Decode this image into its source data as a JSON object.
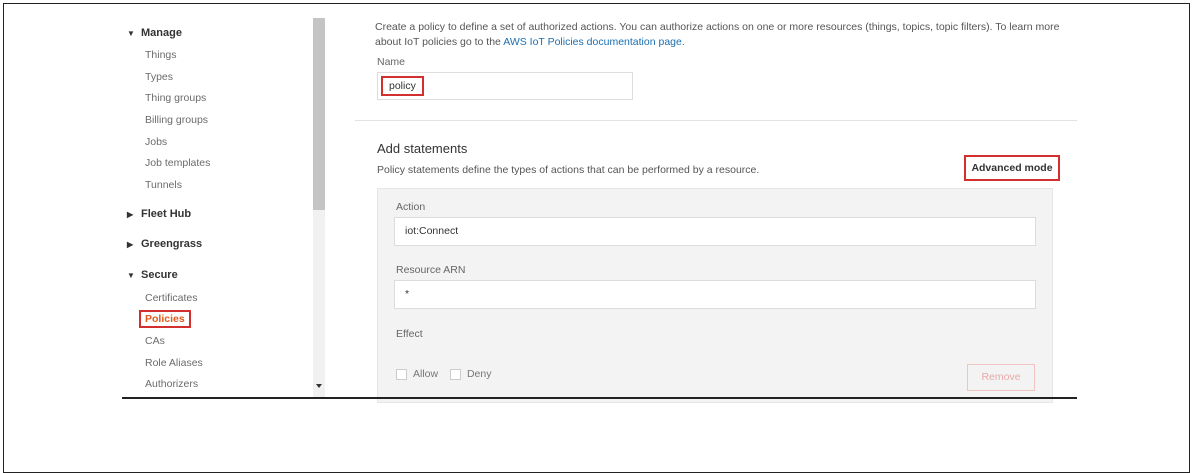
{
  "sidebar": {
    "sections": [
      {
        "label": "Manage",
        "expanded": true,
        "caret": "▼"
      },
      {
        "label": "Fleet Hub",
        "expanded": false,
        "caret": "▶"
      },
      {
        "label": "Greengrass",
        "expanded": false,
        "caret": "▶"
      },
      {
        "label": "Secure",
        "expanded": true,
        "caret": "▼"
      }
    ],
    "manage_items": [
      "Things",
      "Types",
      "Thing groups",
      "Billing groups",
      "Jobs",
      "Job templates",
      "Tunnels"
    ],
    "secure_items": [
      "Certificates",
      "Policies",
      "CAs",
      "Role Aliases",
      "Authorizers"
    ],
    "active_item": "Policies"
  },
  "intro": {
    "text_before": "Create a policy to define a set of authorized actions. You can authorize actions on one or more resources (things, topics, topic filters). To learn more about IoT policies go to the ",
    "link": "AWS IoT Policies documentation page",
    "text_after": "."
  },
  "name_field": {
    "label": "Name",
    "value": "policy"
  },
  "statements": {
    "title": "Add statements",
    "description": "Policy statements define the types of actions that can be performed by a resource.",
    "advanced_mode_label": "Advanced mode",
    "action_label": "Action",
    "action_value": "iot:Connect",
    "resource_label": "Resource ARN",
    "resource_value": "*",
    "effect_label": "Effect",
    "allow_label": "Allow",
    "deny_label": "Deny",
    "remove_label": "Remove"
  },
  "colors": {
    "highlight": "#d32f2f",
    "link": "#1a6fb3",
    "active_nav": "#e05a1b"
  }
}
